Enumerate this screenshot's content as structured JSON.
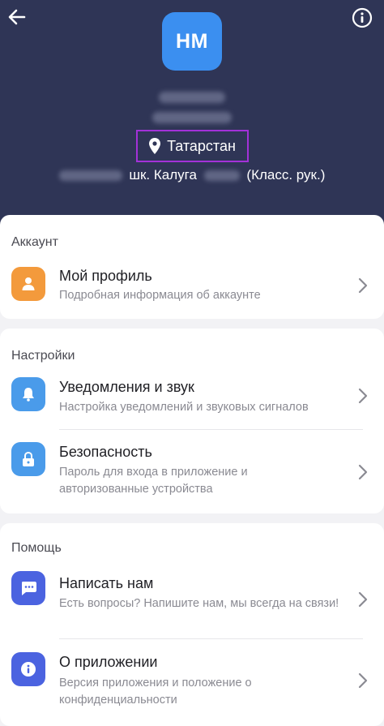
{
  "header": {
    "avatar_initials": "НМ",
    "region": "Татарстан",
    "school_text": "шк. Калуга",
    "role_text": "(Класс. рук.)"
  },
  "account": {
    "section_title": "Аккаунт",
    "profile": {
      "title": "Мой профиль",
      "subtitle": "Подробная информация об аккаунте"
    }
  },
  "settings": {
    "section_title": "Настройки",
    "notifications": {
      "title": "Уведомления и звук",
      "subtitle": "Настройка уведомлений и звуковых сигналов"
    },
    "security": {
      "title": "Безопасность",
      "subtitle": "Пароль для входа в приложение и авторизованные устройства"
    }
  },
  "help": {
    "section_title": "Помощь",
    "contact": {
      "title": "Написать нам",
      "subtitle": "Есть вопросы? Напишите нам, мы всегда на связи!"
    },
    "about": {
      "title": "О приложении",
      "subtitle": "Версия приложения и положение о конфиденциальности"
    }
  },
  "colors": {
    "header_bg": "#2f3556",
    "avatar_bg": "#3b8ff0",
    "profile_icon_bg": "#f39a3c",
    "settings_icon_bg": "#4a9bea",
    "help_icon_bg": "#4b63e0",
    "highlight_border": "#a331d8"
  }
}
